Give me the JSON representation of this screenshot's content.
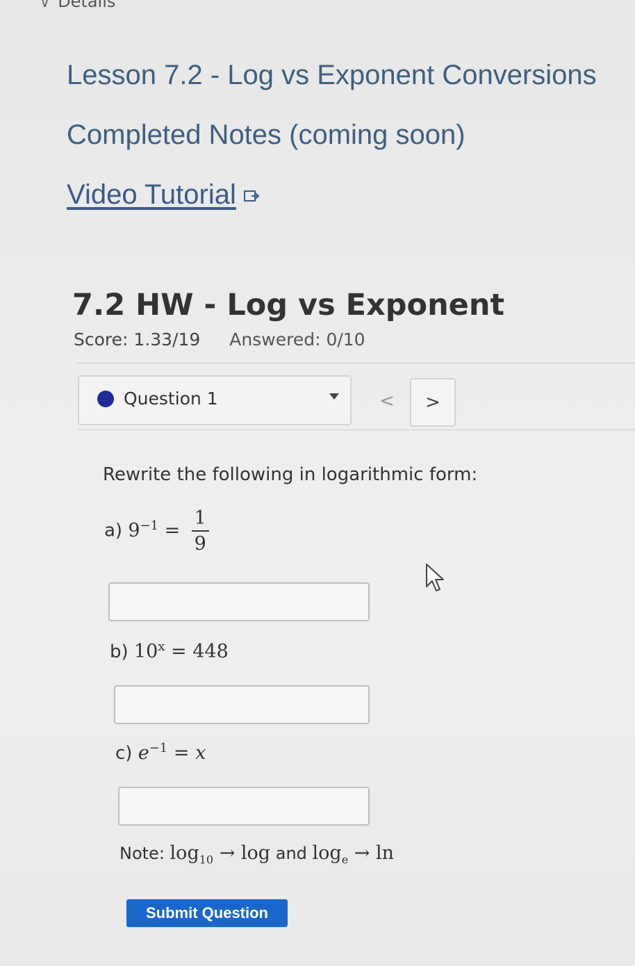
{
  "header": {
    "details_label": "Details"
  },
  "lesson": {
    "title": "Lesson 7.2 - Log vs Exponent Conversions",
    "notes_label": "Completed Notes (coming soon)",
    "video_label": "Video Tutorial",
    "external_link_icon": "external-link-icon"
  },
  "assignment": {
    "title": "7.2 HW - Log vs Exponent",
    "score": "Score: 1.33/19",
    "answered": "Answered: 0/10"
  },
  "question_nav": {
    "selected": "Question 1",
    "status_color": "#1c2d9a",
    "prev_label": "<",
    "next_label": ">"
  },
  "question": {
    "prompt": "Rewrite the following in logarithmic form:",
    "parts": [
      {
        "label": "a)",
        "base": "9",
        "exponent": "−1",
        "equals": "=",
        "numerator": "1",
        "denominator": "9",
        "answer_value": ""
      },
      {
        "label": "b)",
        "base": "10",
        "exponent": "x",
        "equals": "=",
        "rhs": "448",
        "answer_value": ""
      },
      {
        "label": "c)",
        "base": "e",
        "exponent": "−1",
        "equals": "=",
        "rhs": "x",
        "answer_value": ""
      }
    ],
    "note": {
      "prefix": "Note:",
      "log10": "log",
      "log10_sub": "10",
      "arrow": "→",
      "log": "log",
      "and": "and",
      "loge": "log",
      "loge_sub": "e",
      "ln": "ln"
    },
    "submit_label": "Submit Question",
    "submit_color": "#1b66c9"
  }
}
